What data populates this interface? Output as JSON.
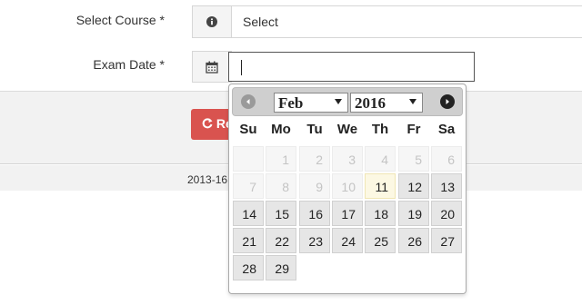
{
  "form": {
    "course_label": "Select Course *",
    "course_value": "Select",
    "date_label": "Exam Date *",
    "date_value": ""
  },
  "icons": {
    "course_addon": "info-icon",
    "date_addon": "calendar-icon"
  },
  "actions": {
    "reset_label": "Re"
  },
  "footer": {
    "text": "2013-16"
  },
  "datepicker": {
    "month": "Feb",
    "year": "2016",
    "weekdays": [
      "Su",
      "Mo",
      "Tu",
      "We",
      "Th",
      "Fr",
      "Sa"
    ],
    "rows": [
      [
        "",
        "1",
        "2",
        "3",
        "4",
        "5",
        "6"
      ],
      [
        "7",
        "8",
        "9",
        "10",
        "11",
        "12",
        "13"
      ],
      [
        "14",
        "15",
        "16",
        "17",
        "18",
        "19",
        "20"
      ],
      [
        "21",
        "22",
        "23",
        "24",
        "25",
        "26",
        "27"
      ],
      [
        "28",
        "29",
        "",
        "",
        "",
        "",
        ""
      ]
    ],
    "today": "11",
    "first_enabled": "11"
  },
  "colors": {
    "reset_button": "#d9534f",
    "today_highlight": "#fcf8e3",
    "header_bg": "#cfcfcf"
  }
}
